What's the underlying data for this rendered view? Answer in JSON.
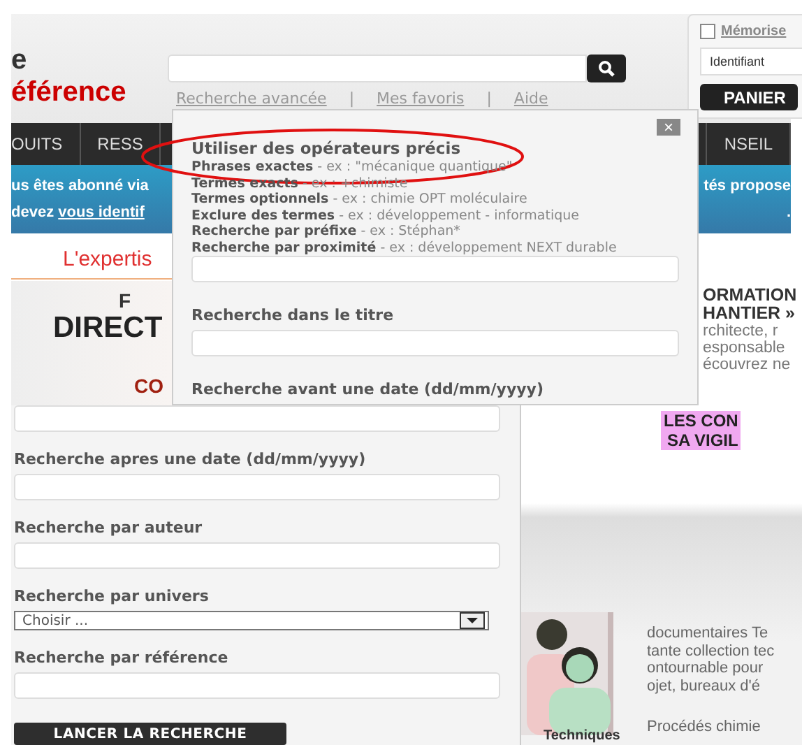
{
  "header": {
    "logo_lines": [
      "e",
      "éférence"
    ],
    "links": [
      "Recherche avancée",
      "Mes favoris",
      "Aide"
    ],
    "link_separator": "|"
  },
  "login": {
    "remember": {
      "label": "Mémorise",
      "checked": false
    },
    "identifier": {
      "placeholder": "Identifiant"
    },
    "cart_button": "PANIER"
  },
  "nav": {
    "items": [
      "OUITS",
      "RESS",
      "NSEIL"
    ]
  },
  "banner": {
    "line_1_left": "us êtes abonné via",
    "line_1_right": "tés propose",
    "line_2_prefix": "devez",
    "line_2_link": "vous identif",
    "line_2_right": "."
  },
  "content": {
    "heading": "L'expertis",
    "promo": [
      "F",
      "DIRECT",
      "CO"
    ],
    "side_title": [
      "ORMATION",
      "HANTIER »"
    ],
    "side_text": [
      "rchitecte, r",
      "esponsable",
      "écouvrez ne"
    ]
  },
  "popup": {
    "close": "×",
    "title": "Utiliser des opérateurs précis",
    "operators": [
      {
        "term": "Phrases exactes",
        "example": "- ex : \"mécanique quantique\""
      },
      {
        "term": "Termes exacts",
        "example": "- ex : +chimiste"
      },
      {
        "term": "Termes optionnels",
        "example": "- ex : chimie OPT moléculaire"
      },
      {
        "term": "Exclure des termes",
        "example": "- ex : développement - informatique"
      },
      {
        "term": "Recherche par préfixe",
        "example": "- ex : Stéphan*"
      },
      {
        "term": "Recherche par proximité",
        "example": "- ex : développement NEXT durable"
      }
    ],
    "fields": [
      {
        "label": "Recherche dans le titre"
      },
      {
        "label": "Recherche avant une date (dd/mm/yyyy)"
      }
    ]
  },
  "lower_form": {
    "fields": [
      {
        "kind": "text",
        "label": "Recherche apres une date (dd/mm/yyyy)"
      },
      {
        "kind": "text",
        "label": "Recherche par auteur"
      },
      {
        "kind": "select",
        "label": "Recherche par univers",
        "value": "Choisir ..."
      },
      {
        "kind": "text",
        "label": "Recherche par référence"
      }
    ],
    "submit": "LANCER LA RECHERCHE"
  },
  "side": {
    "promo_title": [
      "LES CON",
      "SA VIGIL"
    ],
    "text_lines": [
      "documentaires Te",
      "tante collection tec",
      "ontournable pour",
      "ojet, bureaux d'é"
    ],
    "footer": [
      "Procédés chimie",
      "Techniques"
    ]
  }
}
